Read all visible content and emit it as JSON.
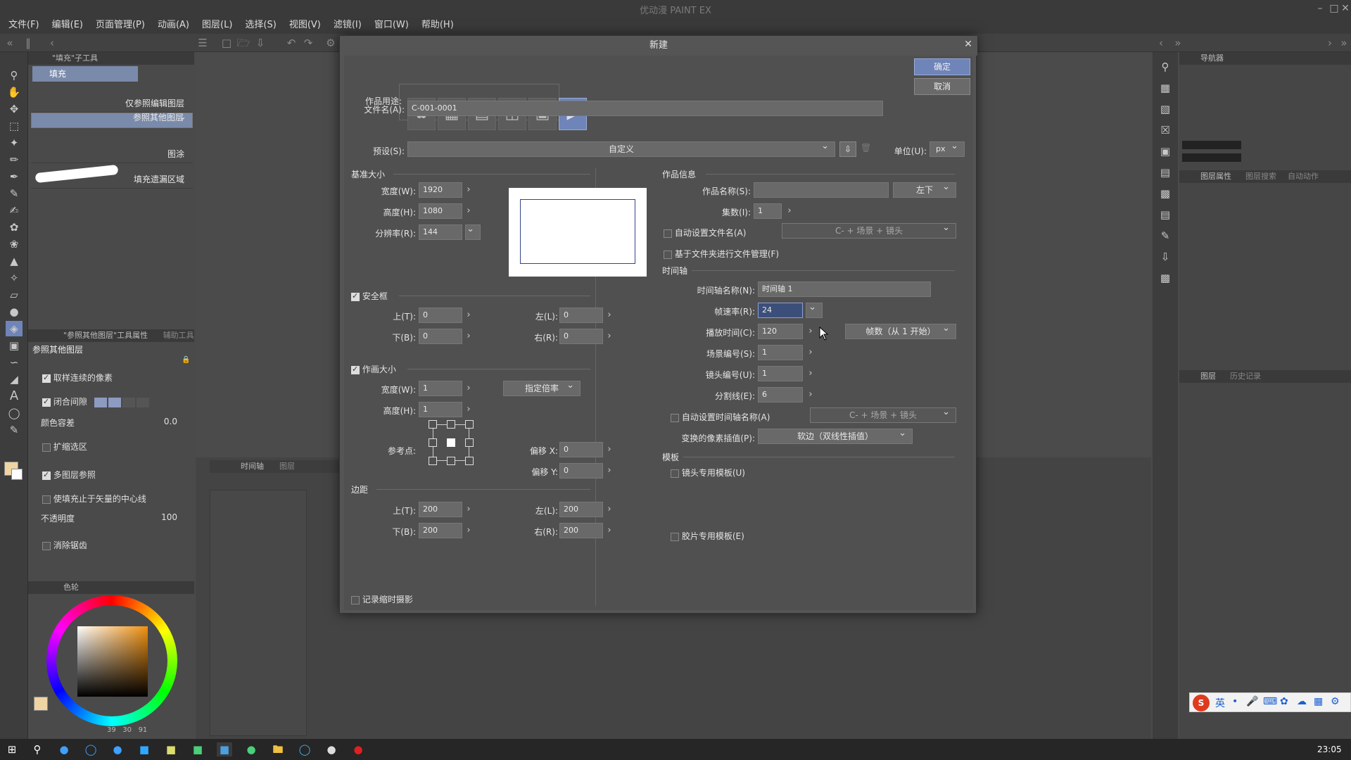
{
  "app": {
    "title": "优动漫 PAINT EX"
  },
  "menu": [
    "文件(F)",
    "编辑(E)",
    "页面管理(P)",
    "动画(A)",
    "图层(L)",
    "选择(S)",
    "视图(V)",
    "滤镜(I)",
    "窗口(W)",
    "帮助(H)"
  ],
  "left_panel": {
    "tool_tab": "\"填充\"子工具",
    "tool_name": "填充",
    "subtools": [
      "仅参照编辑图层",
      "参照其他图层",
      "图涂",
      "填充遗漏区域"
    ],
    "prop_tab": "\"参照其他图层\"工具属性",
    "prop_tab2": "辅助工具",
    "prop_title": "参照其他图层",
    "props": {
      "contiguous": "取样连续的像素",
      "close_gap": "闭合间隙",
      "tolerance_label": "颜色容差",
      "tolerance_value": "0.0",
      "expand": "扩缩选区",
      "multi_ref": "多图层参照",
      "vector_center": "使填充止于矢量的中心线",
      "opacity_label": "不透明度",
      "opacity_value": "100",
      "antialias": "消除锯齿"
    },
    "color_tab": "色轮",
    "color_readout": [
      "39",
      "30",
      "91"
    ]
  },
  "timeline": {
    "tab": "时间轴",
    "tab2": "图层"
  },
  "right_panel": {
    "nav_tab": "导航器",
    "layer_prop_tab": "图层属性",
    "layer_tab": "图层",
    "history_tab": "历史记录",
    "search_tab": "图层搜索",
    "auto_tab": "自动动作"
  },
  "dialog": {
    "title": "新建",
    "ok": "确定",
    "cancel": "取消",
    "purpose_label": "作品用途:",
    "filename_label": "文件名(A):",
    "filename_value": "C-001-0001",
    "preset_label": "预设(S):",
    "preset_value": "自定义",
    "unit_label": "单位(U):",
    "unit_value": "px",
    "base_size": {
      "title": "基准大小",
      "width_label": "宽度(W):",
      "width_value": "1920",
      "height_label": "高度(H):",
      "height_value": "1080",
      "res_label": "分辨率(R):",
      "res_value": "144"
    },
    "safe_frame": {
      "title": "安全框",
      "top_label": "上(T):",
      "top_value": "0",
      "left_label": "左(L):",
      "left_value": "0",
      "bottom_label": "下(B):",
      "bottom_value": "0",
      "right_label": "右(R):",
      "right_value": "0"
    },
    "canvas_size": {
      "title": "作画大小",
      "width_label": "宽度(W):",
      "width_value": "1",
      "height_label": "高度(H):",
      "height_value": "1",
      "mode_value": "指定倍率",
      "ref_label": "参考点:",
      "offx_label": "偏移 X:",
      "offx_value": "0",
      "offy_label": "偏移 Y:",
      "offy_value": "0"
    },
    "margin": {
      "title": "边距",
      "top_label": "上(T):",
      "top_value": "200",
      "left_label": "左(L):",
      "left_value": "200",
      "bottom_label": "下(B):",
      "bottom_value": "200",
      "right_label": "右(R):",
      "right_value": "200"
    },
    "timelapse": "记录缩时摄影",
    "work_info": {
      "title": "作品信息",
      "name_label": "作品名称(S):",
      "name_pos": "左下",
      "episode_label": "集数(I):",
      "episode_value": "1",
      "auto_filename": "自动设置文件名(A)",
      "auto_filename_pattern": "C- + 场景 + 镜头",
      "folder_manage": "基于文件夹进行文件管理(F)"
    },
    "timeline": {
      "title": "时间轴",
      "name_label": "时间轴名称(N):",
      "name_value": "时间轴 1",
      "fps_label": "帧速率(R):",
      "fps_value": "24",
      "duration_label": "播放时间(C):",
      "duration_value": "120",
      "duration_unit": "帧数（从 1 开始）",
      "scene_label": "场景编号(S):",
      "scene_value": "1",
      "cut_label": "镜头编号(U):",
      "cut_value": "1",
      "split_label": "分割线(E):",
      "split_value": "6",
      "auto_tlname": "自动设置时间轴名称(A)",
      "auto_tlname_pattern": "C- + 场景 + 镜头",
      "interp_label": "变换的像素插值(P):",
      "interp_value": "软边（双线性插值）"
    },
    "template": {
      "title": "模板",
      "cut_template": "镜头专用模板(U)",
      "film_template": "胶片专用模板(E)"
    }
  },
  "taskbar": {
    "time": "23:05"
  },
  "ime": {
    "lang": "英"
  },
  "colors": {
    "accent": "#6f84b8",
    "dialog_bg": "#505050",
    "panel_bg": "#4a4a4a"
  }
}
